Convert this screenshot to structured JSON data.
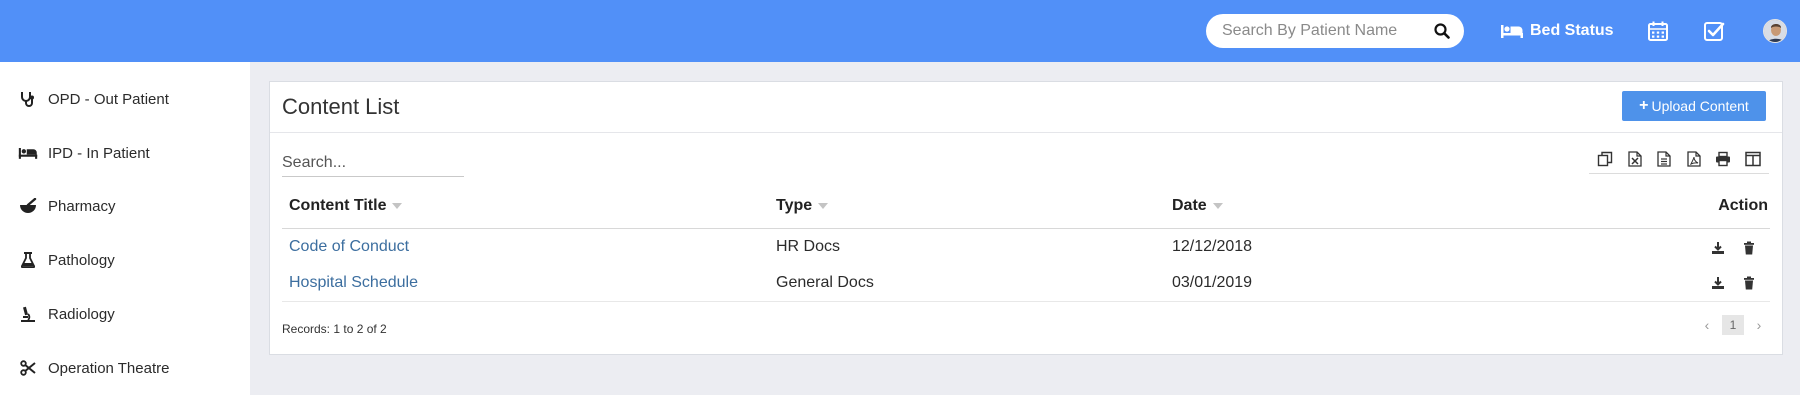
{
  "header": {
    "search_placeholder": "Search By Patient Name",
    "bed_status_label": "Bed Status",
    "icons": [
      "search-icon",
      "bed-icon",
      "calendar-icon",
      "checklist-icon",
      "user-avatar"
    ],
    "background_color": "#5190f8"
  },
  "sidebar": {
    "items": [
      {
        "label": "OPD - Out Patient",
        "icon": "stethoscope-icon"
      },
      {
        "label": "IPD - In Patient",
        "icon": "bed-icon"
      },
      {
        "label": "Pharmacy",
        "icon": "mortar-pestle-icon"
      },
      {
        "label": "Pathology",
        "icon": "flask-icon"
      },
      {
        "label": "Radiology",
        "icon": "microscope-icon"
      },
      {
        "label": "Operation Theatre",
        "icon": "scissors-icon"
      }
    ]
  },
  "content": {
    "title": "Content List",
    "upload_button_label": "Upload Content",
    "search_placeholder": "Search...",
    "toolbar_icons": [
      "copy-icon",
      "excel-icon",
      "csv-icon",
      "pdf-icon",
      "print-icon",
      "columns-icon"
    ],
    "table": {
      "headers": [
        "Content Title",
        "Type",
        "Date",
        "Action"
      ],
      "rows": [
        {
          "title": "Code of Conduct",
          "type": "HR Docs",
          "date": "12/12/2018"
        },
        {
          "title": "Hospital Schedule",
          "type": "General Docs",
          "date": "03/01/2019"
        }
      ]
    },
    "records_text": "Records: 1 to 2 of 2",
    "pagination": {
      "prev": "‹",
      "current_page": "1",
      "next": "›"
    },
    "accent_color": "#4e92ea",
    "link_color": "#3c6e9f"
  }
}
